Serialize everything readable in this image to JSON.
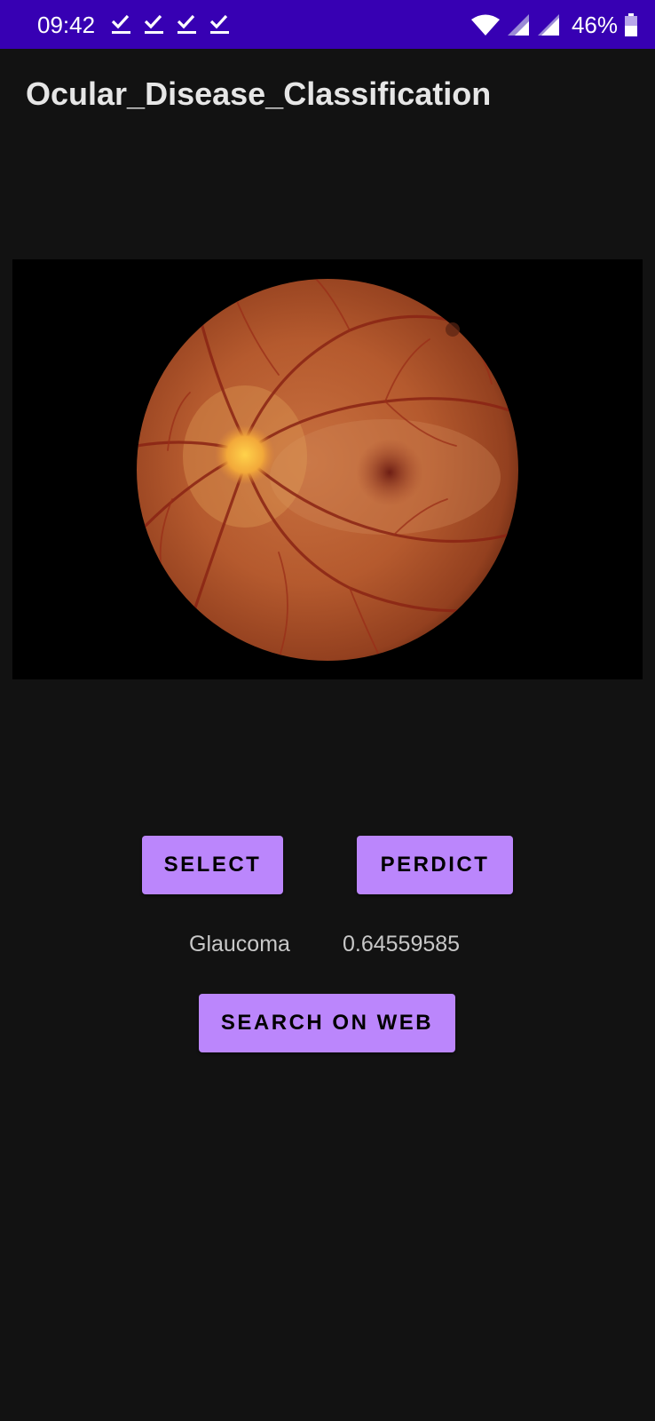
{
  "status_bar": {
    "time": "09:42",
    "notification_icons": [
      "download-done-icon",
      "download-done-icon",
      "download-done-icon",
      "download-done-icon"
    ],
    "battery_percent": "46%",
    "background_color": "#3700B3"
  },
  "app_bar": {
    "title": "Ocular_Disease_Classification"
  },
  "image_view": {
    "content": "retina fundus photograph"
  },
  "buttons": {
    "select_label": "SELECT",
    "predict_label": "PERDICT",
    "search_label": "SEARCH ON WEB",
    "color": "#BB86FC"
  },
  "result": {
    "label": "Glaucoma",
    "score": "0.64559585"
  },
  "theme": {
    "background": "#121212",
    "text": "#e6e6e6"
  }
}
